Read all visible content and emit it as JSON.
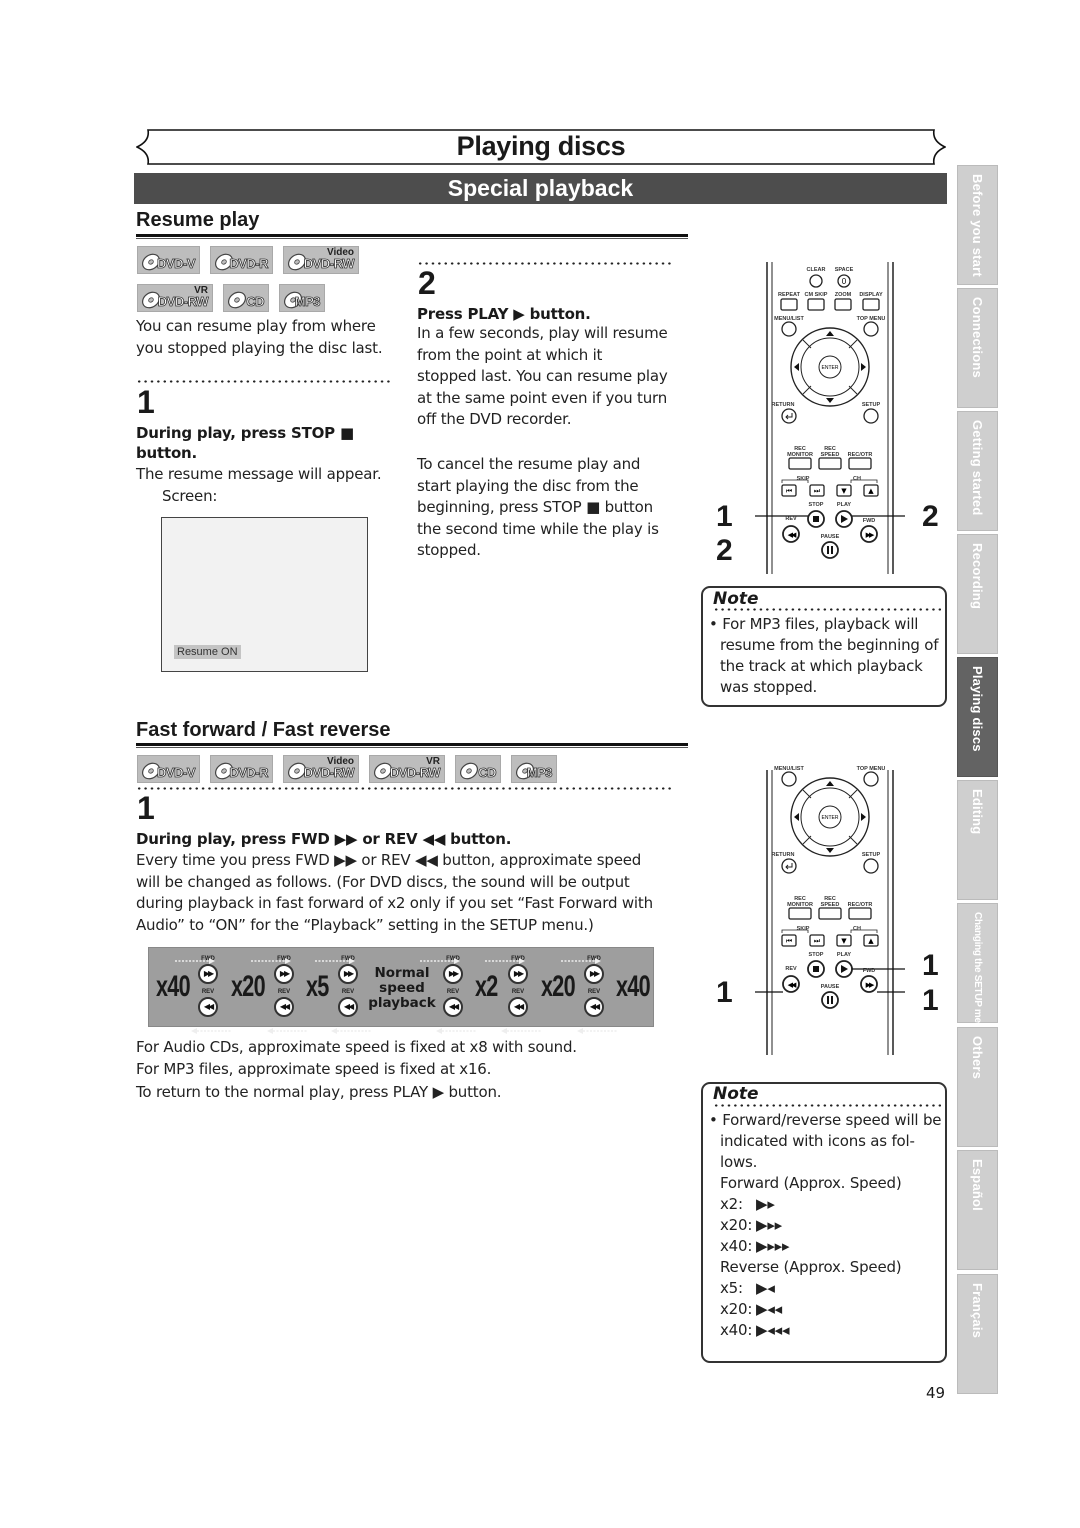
{
  "header": {
    "chapter_title": "Playing discs",
    "section_title": "Special playback"
  },
  "resume": {
    "heading": "Resume play",
    "badges_row1": [
      {
        "label": "DVD-V",
        "sup": ""
      },
      {
        "label": "DVD-R",
        "sup": ""
      },
      {
        "label": "DVD-RW",
        "sup": "Video"
      }
    ],
    "badges_row2": [
      {
        "label": "DVD-RW",
        "sup": "VR"
      },
      {
        "label": "CD",
        "sup": ""
      },
      {
        "label": "MP3",
        "sup": ""
      }
    ],
    "intro": [
      "You can resume play from where",
      "you stopped playing the disc last."
    ],
    "step1": {
      "number": "1",
      "instruction_line1": "During play, press STOP ■",
      "instruction_line2": "button.",
      "desc": "The resume message will appear.",
      "screen_label": "Screen:",
      "screen_message": "Resume ON"
    },
    "step2": {
      "number": "2",
      "instruction": "Press PLAY ▶ button.",
      "desc": [
        "In a few seconds, play will resume",
        "from the point at which it",
        "stopped last. You can resume play",
        "at the same point even if you turn",
        "off the DVD recorder."
      ],
      "cancel": [
        "To cancel the resume play and",
        "start playing the disc from the",
        "beginning, press STOP ■ button",
        "the second time while the play is",
        "stopped."
      ]
    },
    "remote_callouts": {
      "stop": "1",
      "stop2": "2",
      "play": "2"
    },
    "note": {
      "title": "Note",
      "lines": [
        "• For MP3 files, playback will",
        "resume from the beginning of",
        "the track at which playback",
        "was stopped."
      ]
    }
  },
  "remote": {
    "labels": {
      "clear": "CLEAR",
      "space": "SPACE",
      "zero": "0",
      "repeat": "REPEAT",
      "cmskip": "CM SKIP",
      "zoom": "ZOOM",
      "display": "DISPLAY",
      "menulist": "MENU/LIST",
      "topmenu": "TOP MENU",
      "enter": "ENTER",
      "return": "RETURN",
      "setup": "SETUP",
      "recmonitor": "REC MONITOR",
      "recspeed": "REC SPEED",
      "recotr": "REC/OTR",
      "skip": "SKIP",
      "ch": "CH",
      "stop": "STOP",
      "play": "PLAY",
      "rev": "REV",
      "fwd": "FWD",
      "pause": "PAUSE"
    }
  },
  "fast": {
    "heading": "Fast forward / Fast reverse",
    "badges": [
      {
        "label": "DVD-V",
        "sup": ""
      },
      {
        "label": "DVD-R",
        "sup": ""
      },
      {
        "label": "DVD-RW",
        "sup": "Video"
      },
      {
        "label": "DVD-RW",
        "sup": "VR"
      },
      {
        "label": "CD",
        "sup": ""
      },
      {
        "label": "MP3",
        "sup": ""
      }
    ],
    "step1": {
      "number": "1",
      "instruction": "During play, press FWD ▶▶ or REV ◀◀ button.",
      "desc": [
        "Every time you press FWD ▶▶ or REV ◀◀ button, approximate speed",
        "will be changed as follows. (For DVD discs, the sound will be output",
        "during playback in fast forward of x2 only if you set “Fast Forward with",
        "Audio” to “ON” for the “Playback” setting in the SETUP menu.)"
      ]
    },
    "speed_diagram": {
      "speeds": [
        "x40",
        "x20",
        "x5",
        "x2",
        "x20",
        "x40"
      ],
      "normal_label": [
        "Normal",
        "speed",
        "playback"
      ],
      "fwd_label": "FWD",
      "rev_label": "REV"
    },
    "footer_lines": [
      "For Audio CDs, approximate speed is fixed at x8 with sound.",
      "For MP3 files, approximate speed is fixed at x16.",
      "To return to the normal play, press PLAY ▶ button."
    ],
    "remote_callouts": {
      "play": "1",
      "rev": "1",
      "fwd": "1"
    },
    "note": {
      "title": "Note",
      "lines": [
        "• Forward/reverse speed will be",
        "indicated with icons as fol-",
        "lows."
      ],
      "forward_heading": "Forward (Approx. Speed)",
      "forward": [
        {
          "speed": "x2:",
          "icon": "▶▸"
        },
        {
          "speed": "x20:",
          "icon": "▶▸▸"
        },
        {
          "speed": "x40:",
          "icon": "▶▸▸▸"
        }
      ],
      "reverse_heading": "Reverse (Approx. Speed)",
      "reverse": [
        {
          "speed": "x5:",
          "icon": "▶◂"
        },
        {
          "speed": "x20:",
          "icon": "▶◂◂"
        },
        {
          "speed": "x40:",
          "icon": "▶◂◂◂"
        }
      ]
    }
  },
  "side_tabs": [
    {
      "label": "Before you start",
      "active": false
    },
    {
      "label": "Connections",
      "active": false
    },
    {
      "label": "Getting started",
      "active": false
    },
    {
      "label": "Recording",
      "active": false
    },
    {
      "label": "Playing discs",
      "active": true
    },
    {
      "label": "Editing",
      "active": false
    },
    {
      "label": "Changing the SETUP menu",
      "active": false
    },
    {
      "label": "Others",
      "active": false
    },
    {
      "label": "Español",
      "active": false
    },
    {
      "label": "Français",
      "active": false
    }
  ],
  "page_number": "49"
}
